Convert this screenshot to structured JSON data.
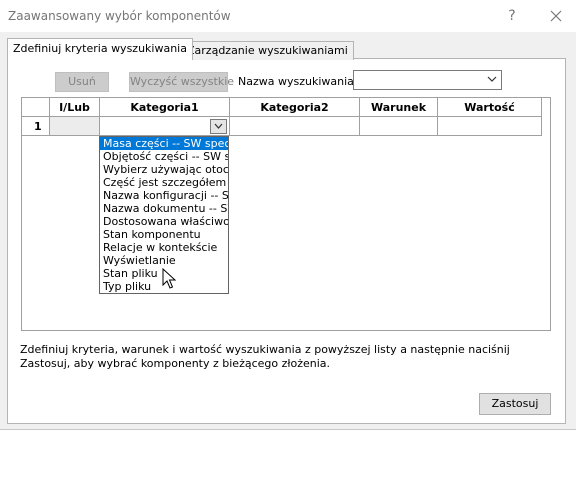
{
  "window": {
    "title": "Zaawansowany wybór komponentów",
    "help_label": "?"
  },
  "tabs": [
    {
      "label": "Zdefiniuj kryteria wyszukiwania",
      "active": true
    },
    {
      "label": "Zarządzanie wyszukiwaniami",
      "active": false
    }
  ],
  "toolbar": {
    "remove_label": "Usuń",
    "clear_all_label": "Wyczyść wszystkie",
    "search_name_label": "Nazwa wyszukiwania:",
    "search_name_value": ""
  },
  "grid": {
    "columns": [
      "",
      "I/Lub",
      "Kategoria1",
      "Kategoria2",
      "Warunek",
      "Wartość"
    ],
    "rows": [
      {
        "num": "1",
        "and_or": "",
        "category1": "",
        "category2": "",
        "condition": "",
        "value": ""
      }
    ]
  },
  "category1_dropdown": {
    "selected_index": 0,
    "options": [
      "Masa części -- SW specjalna",
      "Objętość części -- SW specjalna",
      "Wybierz używając otoczki",
      "Część jest szczegółem wewnętrznym",
      "Nazwa konfiguracji -- SW specjalna",
      "Nazwa dokumentu -- SW specjalna",
      "Dostosowana właściwość",
      "Stan komponentu",
      "Relacje w kontekście",
      "Wyświetlanie",
      "Stan pliku",
      "Typ pliku"
    ]
  },
  "description": "Zdefiniuj kryteria, warunek i wartość wyszukiwania z powyższej listy a następnie naciśnij Zastosuj, aby wybrać komponenty z bieżącego złożenia.",
  "apply_label": "Zastosuj",
  "icons": {
    "close": "close-icon",
    "help": "help-icon",
    "dropdown": "chevron-down-icon",
    "cursor": "mouse-pointer-icon"
  },
  "colors": {
    "selection": "#0078d7",
    "dialog_bg": "#f0f0f0",
    "title_text": "#767676"
  }
}
